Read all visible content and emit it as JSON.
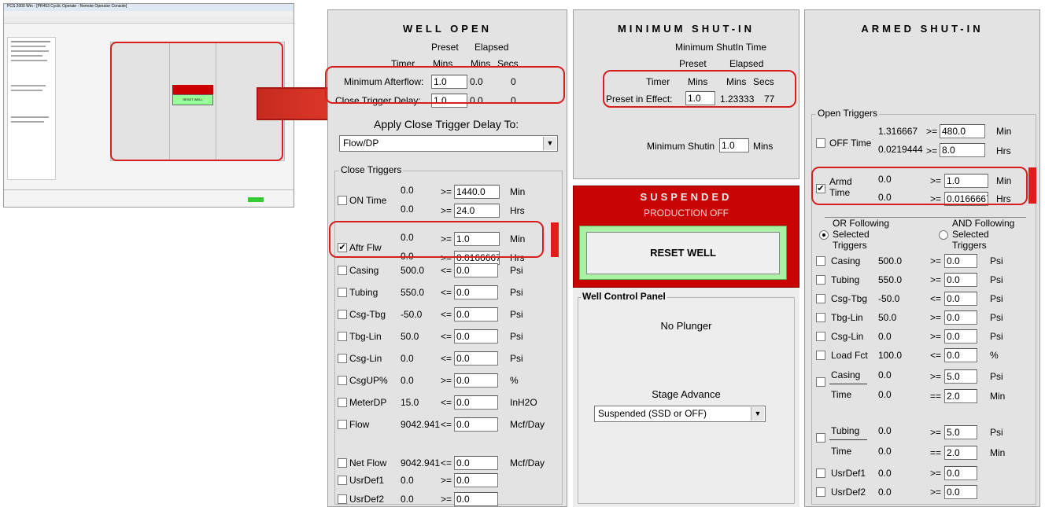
{
  "thumbnail": {
    "window_title": "PCS 2000 Win - [PR453 Cyclic Operate - Remote Operator Console]",
    "button_label": "RESET WELL"
  },
  "well_open": {
    "title": "WELL OPEN",
    "hdr_preset": "Preset",
    "hdr_elapsed": "Elapsed",
    "hdr_timer": "Timer",
    "hdr_mins1": "Mins",
    "hdr_mins2": "Mins",
    "hdr_secs": "Secs",
    "min_afterflow_label": "Minimum Afterflow:",
    "min_afterflow_value": "1.0",
    "min_afterflow_elapsed": "0.0",
    "min_afterflow_secs": "0",
    "close_delay_label": "Close Trigger Delay:",
    "close_delay_value": "1.0",
    "close_delay_elapsed": "0.0",
    "close_delay_secs": "0",
    "apply_label": "Apply Close Trigger Delay To:",
    "apply_value": "Flow/DP",
    "close_triggers_label": "Close Triggers",
    "triggers": [
      {
        "label": "ON Time",
        "checked": false,
        "v1": "0.0",
        "op1": ">=",
        "in1": "1440.0",
        "u1": "Min",
        "v2": "0.0",
        "op2": ">=",
        "in2": "24.0",
        "u2": "Hrs"
      },
      {
        "label": "Aftr Flw",
        "checked": true,
        "v1": "0.0",
        "op1": ">=",
        "in1": "1.0",
        "u1": "Min",
        "v2": "0.0",
        "op2": ">=",
        "in2": "0.0166667",
        "u2": "Hrs"
      },
      {
        "label": "Casing",
        "val": "500.0",
        "op": "<=",
        "in": "0.0",
        "u": "Psi"
      },
      {
        "label": "Tubing",
        "val": "550.0",
        "op": "<=",
        "in": "0.0",
        "u": "Psi"
      },
      {
        "label": "Csg-Tbg",
        "val": "-50.0",
        "op": "<=",
        "in": "0.0",
        "u": "Psi"
      },
      {
        "label": "Tbg-Lin",
        "val": "50.0",
        "op": "<=",
        "in": "0.0",
        "u": "Psi"
      },
      {
        "label": "Csg-Lin",
        "val": "0.0",
        "op": "<=",
        "in": "0.0",
        "u": "Psi"
      },
      {
        "label": "CsgUP%",
        "val": "0.0",
        "op": ">=",
        "in": "0.0",
        "u": "%"
      },
      {
        "label": "MeterDP",
        "val": "15.0",
        "op": "<=",
        "in": "0.0",
        "u": "InH2O"
      },
      {
        "label": "Flow",
        "val": "9042.941",
        "op": "<=",
        "in": "0.0",
        "u": "Mcf/Day"
      },
      {
        "label": "Net Flow",
        "val": "9042.941",
        "op": "<=",
        "in": "0.0",
        "u": "Mcf/Day"
      },
      {
        "label": "UsrDef1",
        "val": "0.0",
        "op": ">=",
        "in": "0.0",
        "u": ""
      },
      {
        "label": "UsrDef2",
        "val": "0.0",
        "op": ">=",
        "in": "0.0",
        "u": ""
      }
    ]
  },
  "min_shutin": {
    "title": "MINIMUM SHUT-IN",
    "subtitle": "Minimum ShutIn Time",
    "hdr_preset": "Preset",
    "hdr_elapsed": "Elapsed",
    "hdr_timer": "Timer",
    "hdr_mins1": "Mins",
    "hdr_mins2": "Mins",
    "hdr_secs": "Secs",
    "preset_label": "Preset in Effect:",
    "preset_value": "1.0",
    "elapsed_value": "1.23333",
    "secs_value": "77",
    "min_shutin_label": "Minimum Shutin",
    "min_shutin_value": "1.0",
    "min_shutin_unit": "Mins",
    "status_title": "SUSPENDED",
    "status_sub": "PRODUCTION OFF",
    "reset_button": "RESET WELL",
    "wcp_label": "Well Control Panel",
    "plunger": "No Plunger",
    "stage_label": "Stage Advance",
    "stage_value": "Suspended (SSD or OFF)"
  },
  "armed": {
    "title": "ARMED SHUT-IN",
    "open_triggers_label": "Open Triggers",
    "off_time": {
      "label": "OFF Time",
      "v1": "1.316667",
      "op1": ">=",
      "in1": "480.0",
      "u1": "Min",
      "v2": "0.0219444",
      "op2": ">=",
      "in2": "8.0",
      "u2": "Hrs"
    },
    "armd_time": {
      "label1": "Armd",
      "label2": "Time",
      "v1": "0.0",
      "op1": ">=",
      "in1": "1.0",
      "u1": "Min",
      "v2": "0.0",
      "op2": ">=",
      "in2": "0.0166667",
      "u2": "Hrs"
    },
    "or_label": "OR Following",
    "or_sub1": "Selected",
    "or_sub2": "Triggers",
    "and_label": "AND Following",
    "and_sub1": "Selected",
    "and_sub2": "Triggers",
    "rows": [
      {
        "label": "Casing",
        "val": "500.0",
        "op": ">=",
        "in": "0.0",
        "u": "Psi"
      },
      {
        "label": "Tubing",
        "val": "550.0",
        "op": ">=",
        "in": "0.0",
        "u": "Psi"
      },
      {
        "label": "Csg-Tbg",
        "val": "-50.0",
        "op": "<=",
        "in": "0.0",
        "u": "Psi"
      },
      {
        "label": "Tbg-Lin",
        "val": "50.0",
        "op": ">=",
        "in": "0.0",
        "u": "Psi"
      },
      {
        "label": "Csg-Lin",
        "val": "0.0",
        "op": ">=",
        "in": "0.0",
        "u": "Psi"
      },
      {
        "label": "Load Fct",
        "val": "100.0",
        "op": "<=",
        "in": "0.0",
        "u": "%"
      }
    ],
    "casing_time": {
      "l1": "Casing",
      "v1": "0.0",
      "op1": ">=",
      "in1": "5.0",
      "u1": "Psi",
      "l2": "Time",
      "v2": "0.0",
      "op2": "==",
      "in2": "2.0",
      "u2": "Min"
    },
    "tubing_time": {
      "l1": "Tubing",
      "v1": "0.0",
      "op1": ">=",
      "in1": "5.0",
      "u1": "Psi",
      "l2": "Time",
      "v2": "0.0",
      "op2": "==",
      "in2": "2.0",
      "u2": "Min"
    },
    "usr": [
      {
        "label": "UsrDef1",
        "val": "0.0",
        "op": ">=",
        "in": "0.0"
      },
      {
        "label": "UsrDef2",
        "val": "0.0",
        "op": ">=",
        "in": "0.0"
      }
    ]
  }
}
